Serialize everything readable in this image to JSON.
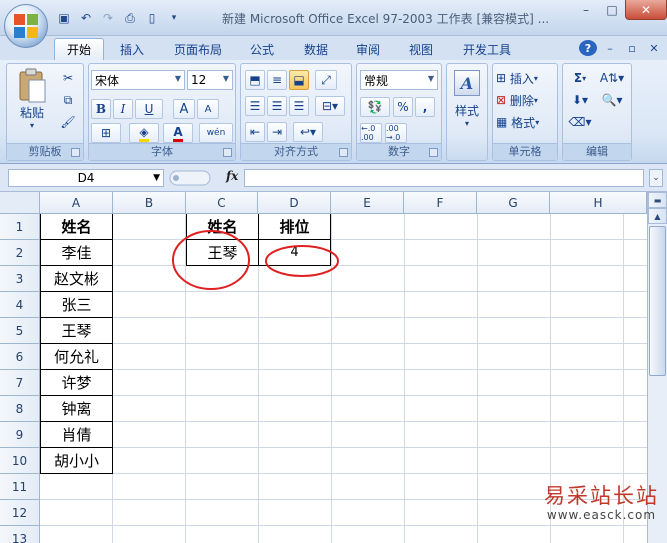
{
  "title": "新建 Microsoft Office Excel 97-2003 工作表 [兼容模式] ...",
  "window_controls": {
    "minimize": "–",
    "maximize": "□",
    "close": "✕"
  },
  "quick_access": [
    "save-icon",
    "undo-icon",
    "redo-icon",
    "print-preview-icon",
    "new-icon",
    "customize-icon"
  ],
  "tabs": [
    "开始",
    "插入",
    "页面布局",
    "公式",
    "数据",
    "审阅",
    "视图",
    "开发工具"
  ],
  "active_tab": "开始",
  "ribbon_ctrls": {
    "help": "?",
    "minimize": "–",
    "restore": "▫",
    "close": "✕"
  },
  "ribbon": {
    "clipboard": {
      "label": "剪贴板",
      "paste": "粘贴"
    },
    "font": {
      "label": "字体",
      "font_name": "宋体",
      "font_size": "12",
      "bold": "B",
      "italic": "I",
      "underline": "U",
      "grow": "A",
      "shrink": "A",
      "font_color": "A",
      "phonetic": "wén"
    },
    "alignment": {
      "label": "对齐方式"
    },
    "number": {
      "label": "数字",
      "format": "常规",
      "percent": "%",
      "comma": ",",
      "inc_decimal": "←.0 .00",
      "dec_decimal": ".00 →.0"
    },
    "styles": {
      "label": "样式",
      "button": "样式"
    },
    "cells": {
      "label": "单元格",
      "insert": "插入",
      "delete": "删除",
      "format": "格式"
    },
    "editing": {
      "label": "编辑",
      "sum": "Σ"
    }
  },
  "formula_bar": {
    "name_box": "D4",
    "fx": "fx",
    "value": ""
  },
  "columns": [
    "A",
    "B",
    "C",
    "D",
    "E",
    "F",
    "G",
    "H"
  ],
  "rows": [
    "1",
    "2",
    "3",
    "4",
    "5",
    "6",
    "7",
    "8",
    "9",
    "10",
    "11",
    "12",
    "13"
  ],
  "sheet": {
    "a_header": "姓名",
    "a_names": [
      "李佳",
      "赵文彬",
      "张三",
      "王琴",
      "何允礼",
      "许梦",
      "钟离",
      "肖倩",
      "胡小小"
    ],
    "c_header": "姓名",
    "d_header": "排位",
    "c_value": "王琴",
    "d_value": "4"
  },
  "watermark": {
    "main": "易采站长站",
    "sub": "www.easck.com"
  },
  "colors": {
    "annotation": "#e02020",
    "ribbon_blue": "#15428b"
  }
}
